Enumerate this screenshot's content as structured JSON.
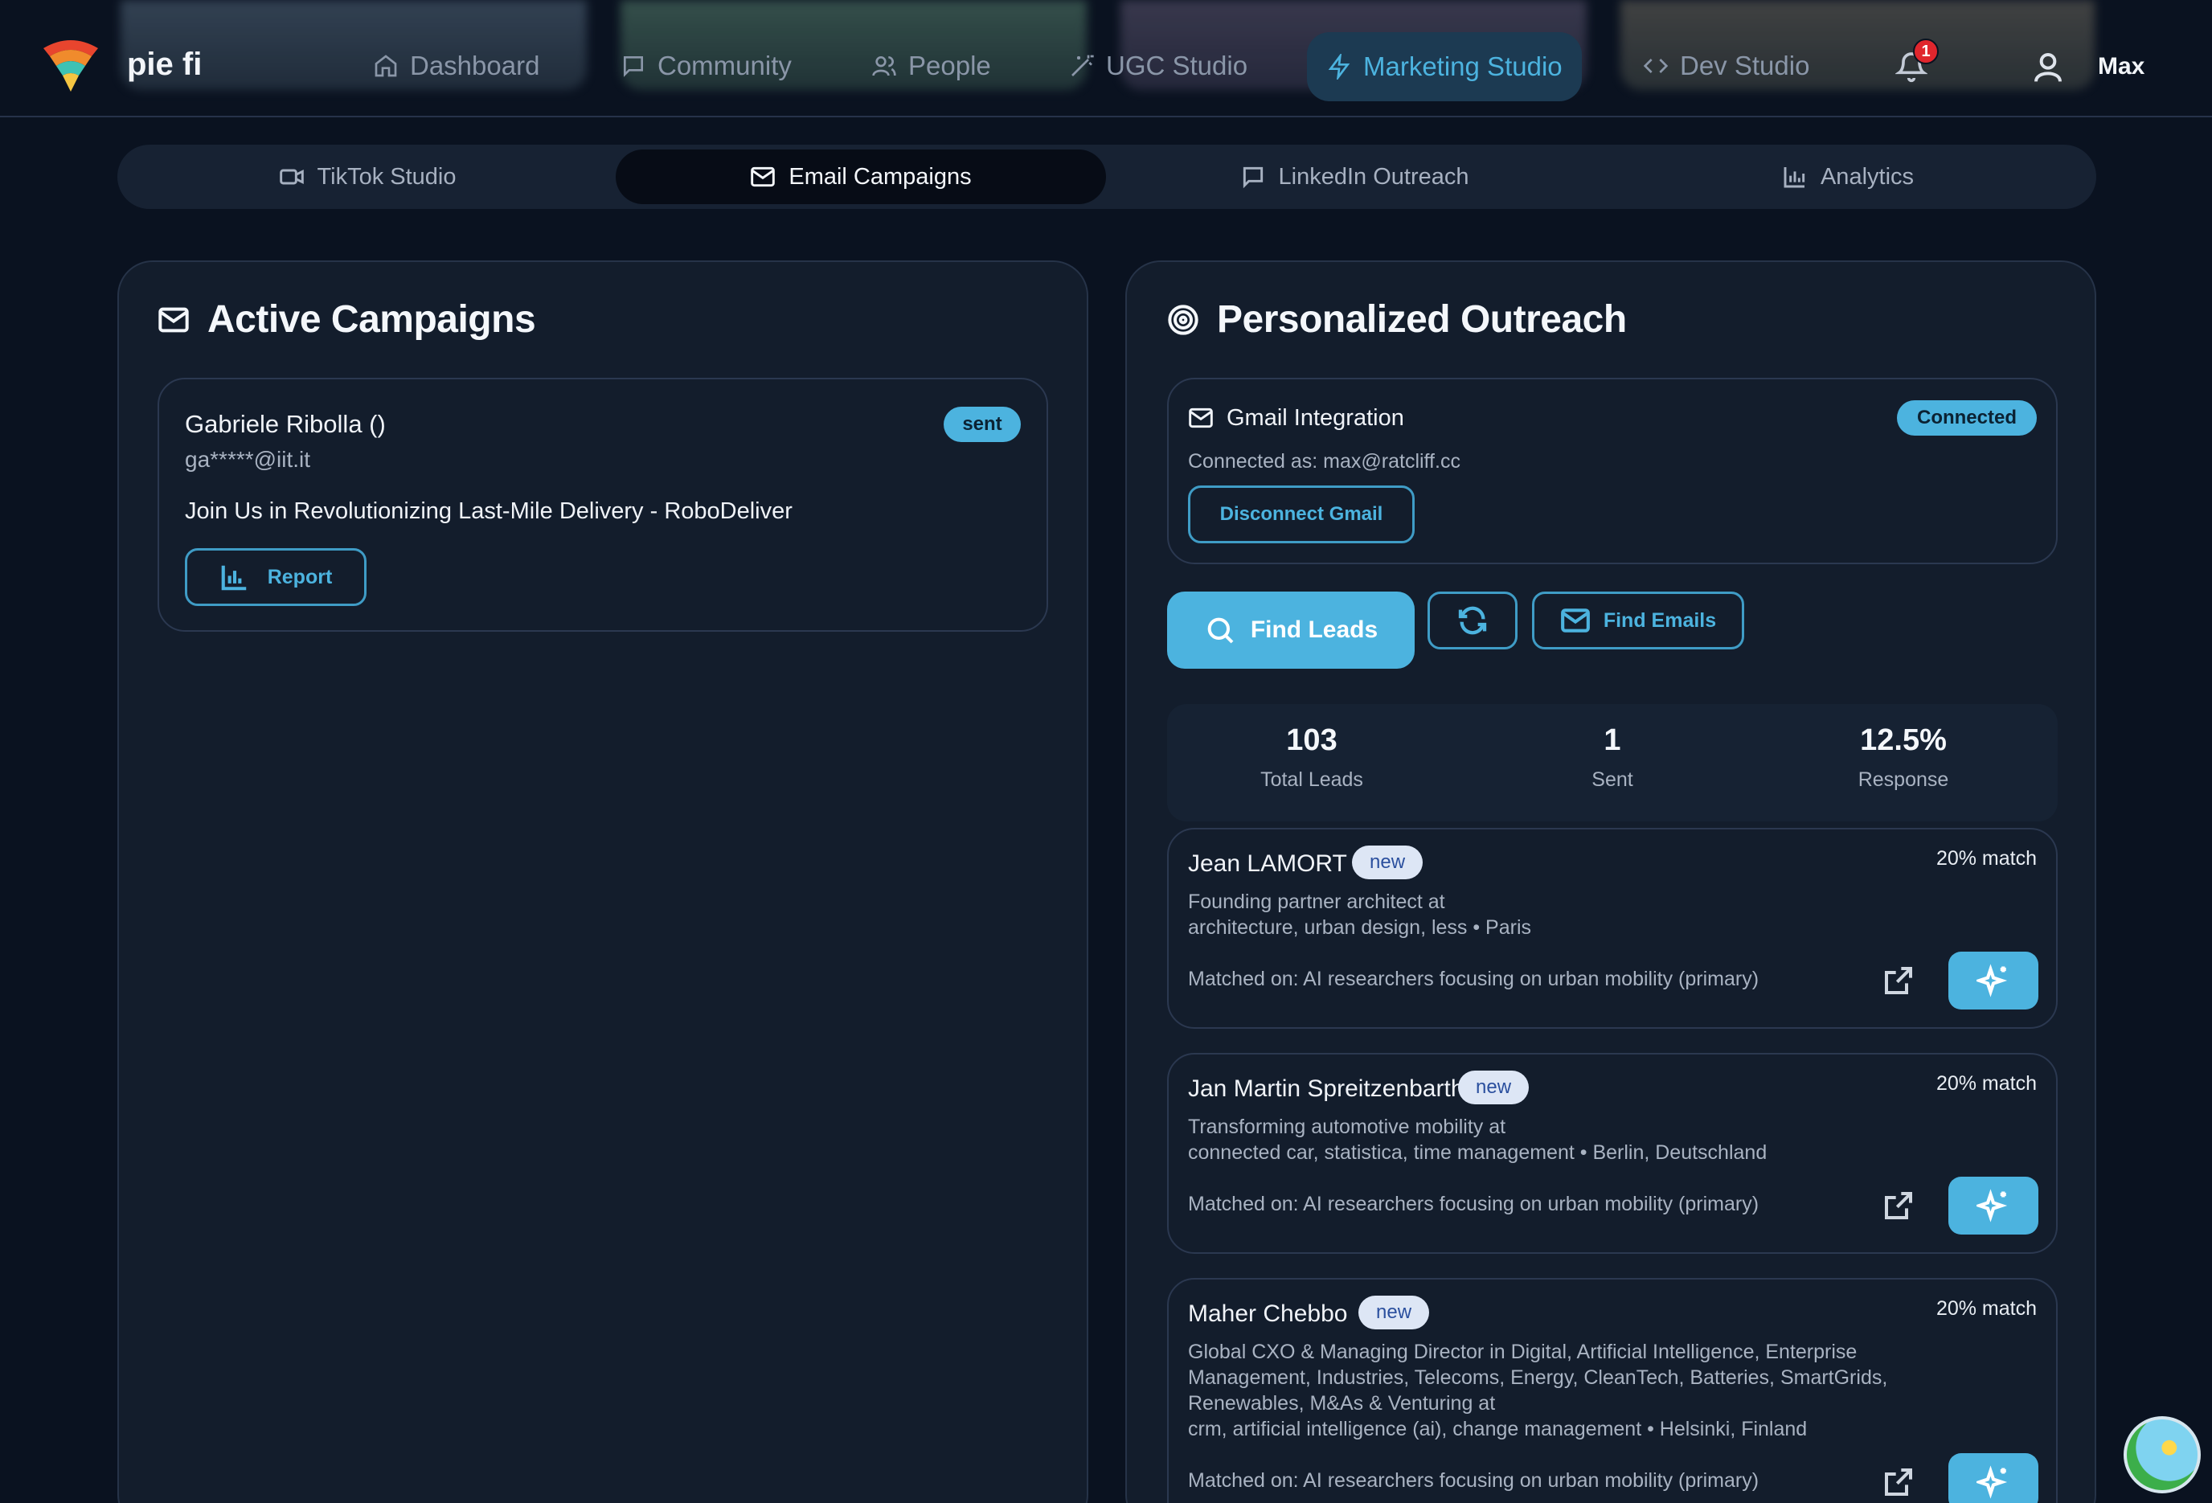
{
  "app": {
    "brand": "pie fi",
    "username": "Max",
    "notification_count": "1"
  },
  "nav": {
    "items": [
      {
        "label": "Dashboard",
        "icon": "home-icon"
      },
      {
        "label": "Community",
        "icon": "message-square-icon"
      },
      {
        "label": "People",
        "icon": "users-icon"
      },
      {
        "label": "UGC Studio",
        "icon": "magic-wand-icon"
      },
      {
        "label": "Marketing Studio",
        "icon": "lightning-icon",
        "active": true
      },
      {
        "label": "Dev Studio",
        "icon": "code-icon"
      }
    ]
  },
  "subtabs": [
    {
      "label": "TikTok Studio",
      "icon": "video-icon"
    },
    {
      "label": "Email Campaigns",
      "icon": "mail-icon",
      "active": true
    },
    {
      "label": "LinkedIn Outreach",
      "icon": "message-square-icon"
    },
    {
      "label": "Analytics",
      "icon": "bar-chart-icon"
    }
  ],
  "campaigns": {
    "title": "Active Campaigns",
    "items": [
      {
        "name": "Gabriele Ribolla ()",
        "email": "ga*****@iit.it",
        "status": "sent",
        "subject": "Join Us in Revolutionizing Last-Mile Delivery - RoboDeliver",
        "report_label": "Report"
      }
    ]
  },
  "outreach": {
    "title": "Personalized Outreach",
    "gmail": {
      "title": "Gmail Integration",
      "status": "Connected",
      "connected_as": "Connected as: max@ratcliff.cc",
      "disconnect_label": "Disconnect Gmail"
    },
    "actions": {
      "find_leads": "Find Leads",
      "find_emails": "Find Emails"
    },
    "stats": [
      {
        "value": "103",
        "label": "Total Leads"
      },
      {
        "value": "1",
        "label": "Sent"
      },
      {
        "value": "12.5%",
        "label": "Response"
      }
    ],
    "leads": [
      {
        "name": "Jean LAMORT",
        "badge": "new",
        "match": "20% match",
        "headline": "Founding partner architect at",
        "details": "architecture, urban design, less • Paris",
        "matched_on": "Matched on: AI researchers focusing on urban mobility (primary)"
      },
      {
        "name": "Jan Martin Spreitzenbarth",
        "badge": "new",
        "match": "20% match",
        "headline": "Transforming automotive mobility at",
        "details": "connected car, statistica, time management • Berlin, Deutschland",
        "matched_on": "Matched on: AI researchers focusing on urban mobility (primary)"
      },
      {
        "name": "Maher Chebbo",
        "badge": "new",
        "match": "20% match",
        "headline": "Global CXO & Managing Director in Digital, Artificial Intelligence, Enterprise Management, Industries, Telecoms, Energy, CleanTech, Batteries, SmartGrids, Renewables, M&As & Venturing at",
        "details": "crm, artificial intelligence (ai), change management • Helsinki, Finland",
        "matched_on": "Matched on: AI researchers focusing on urban mobility (primary)"
      }
    ]
  },
  "colors": {
    "accent": "#4cb3df",
    "background": "#0a1220",
    "panel": "#131d2c",
    "badge_red": "#e0262d"
  }
}
